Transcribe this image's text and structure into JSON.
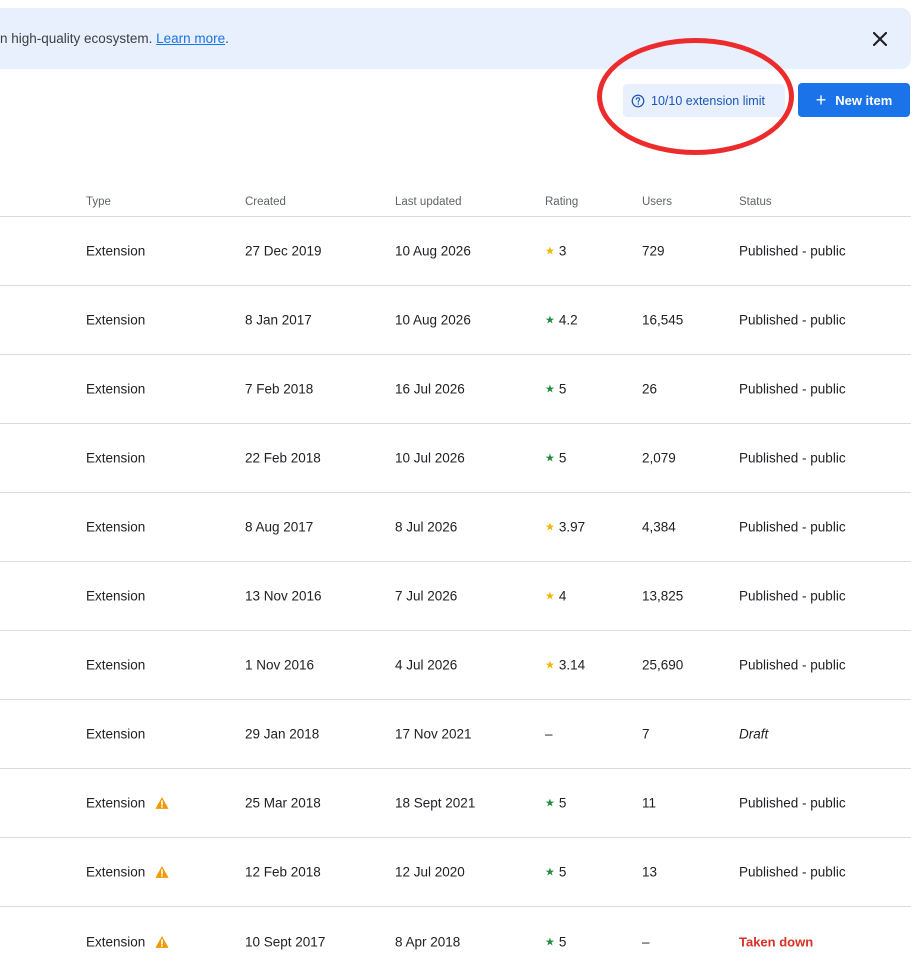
{
  "banner": {
    "text": "n high-quality ecosystem. ",
    "link": "Learn more",
    "after_link": ".",
    "close_icon": "close-icon"
  },
  "toolbar": {
    "limit_label": "10/10 extension limit",
    "limit_icon": "help-circle-icon",
    "new_item_plus": "+",
    "new_item_label": "New item"
  },
  "colors": {
    "accent": "#1a73e8",
    "chip_bg": "#e8f0fe",
    "star_gold": "#f4b400",
    "star_green": "#1e8e3e",
    "warning": "#f29900",
    "taken_down": "#d93025",
    "annotation": "#ec2c2c"
  },
  "table": {
    "headers": {
      "type": "Type",
      "created": "Created",
      "updated": "Last updated",
      "rating": "Rating",
      "users": "Users",
      "status": "Status"
    },
    "rows": [
      {
        "type": "Extension",
        "warning": false,
        "created": "27 Dec 2019",
        "updated": "10 Aug 2026",
        "star": "★",
        "rating": "3",
        "star_color": "gold",
        "users": "729",
        "status": "Published - public",
        "status_kind": "normal"
      },
      {
        "type": "Extension",
        "warning": false,
        "created": "8 Jan 2017",
        "updated": "10 Aug 2026",
        "star": "★",
        "rating": "4.2",
        "star_color": "green",
        "users": "16,545",
        "status": "Published - public",
        "status_kind": "normal"
      },
      {
        "type": "Extension",
        "warning": false,
        "created": "7 Feb 2018",
        "updated": "16 Jul 2026",
        "star": "★",
        "rating": "5",
        "star_color": "green",
        "users": "26",
        "status": "Published - public",
        "status_kind": "normal"
      },
      {
        "type": "Extension",
        "warning": false,
        "created": "22 Feb 2018",
        "updated": "10 Jul 2026",
        "star": "★",
        "rating": "5",
        "star_color": "green",
        "users": "2,079",
        "status": "Published - public",
        "status_kind": "normal"
      },
      {
        "type": "Extension",
        "warning": false,
        "created": "8 Aug 2017",
        "updated": "8 Jul 2026",
        "star": "★",
        "rating": "3.97",
        "star_color": "gold",
        "users": "4,384",
        "status": "Published - public",
        "status_kind": "normal"
      },
      {
        "type": "Extension",
        "warning": false,
        "created": "13 Nov 2016",
        "updated": "7 Jul 2026",
        "star": "★",
        "rating": "4",
        "star_color": "gold",
        "users": "13,825",
        "status": "Published - public",
        "status_kind": "normal"
      },
      {
        "type": "Extension",
        "warning": false,
        "created": "1 Nov 2016",
        "updated": "4 Jul 2026",
        "star": "★",
        "rating": "3.14",
        "star_color": "gold",
        "users": "25,690",
        "status": "Published - public",
        "status_kind": "normal"
      },
      {
        "type": "Extension",
        "warning": false,
        "created": "29 Jan 2018",
        "updated": "17 Nov 2021",
        "star": "",
        "rating": "–",
        "star_color": "none",
        "users": "7",
        "status": "Draft",
        "status_kind": "draft"
      },
      {
        "type": "Extension",
        "warning": true,
        "created": "25 Mar 2018",
        "updated": "18 Sept 2021",
        "star": "★",
        "rating": "5",
        "star_color": "green",
        "users": "11",
        "status": "Published - public",
        "status_kind": "normal"
      },
      {
        "type": "Extension",
        "warning": true,
        "created": "12 Feb 2018",
        "updated": "12 Jul 2020",
        "star": "★",
        "rating": "5",
        "star_color": "green",
        "users": "13",
        "status": "Published - public",
        "status_kind": "normal"
      },
      {
        "type": "Extension",
        "warning": true,
        "created": "10 Sept 2017",
        "updated": "8 Apr 2018",
        "star": "★",
        "rating": "5",
        "star_color": "green",
        "users": "–",
        "status": "Taken down",
        "status_kind": "taken-down"
      }
    ]
  }
}
